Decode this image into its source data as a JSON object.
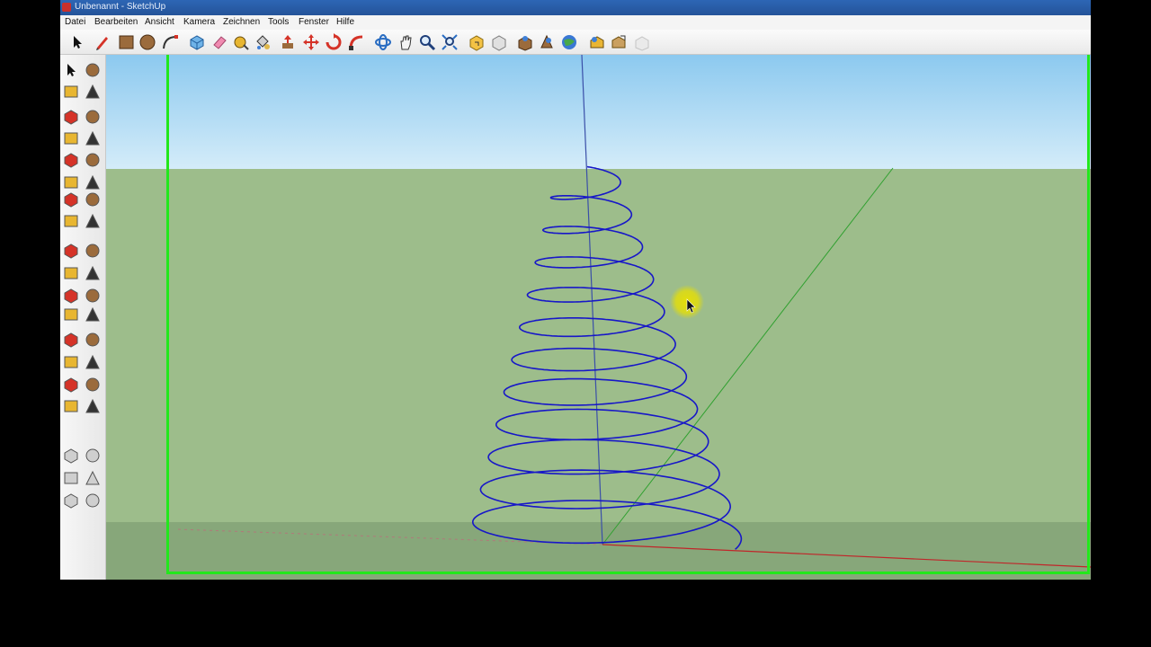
{
  "window": {
    "title": "Unbenannt - SketchUp"
  },
  "menu": {
    "items": [
      {
        "label": "Datei"
      },
      {
        "label": "Bearbeiten"
      },
      {
        "label": "Ansicht"
      },
      {
        "label": "Kamera"
      },
      {
        "label": "Zeichnen"
      },
      {
        "label": "Tools"
      },
      {
        "label": "Fenster"
      },
      {
        "label": "Hilfe"
      }
    ]
  },
  "colors": {
    "sky_top": "#8cc9ef",
    "sky_bottom": "#d4ecf9",
    "ground": "#9dbd8b",
    "ground_dark": "#87a77a",
    "spiral": "#1717c8",
    "axis_blue": "#3a4fa8",
    "axis_red": "#c0262a",
    "axis_green": "#2fa02f",
    "record_frame": "#22e81c",
    "cursor_highlight": "#e8e000"
  },
  "toolbar_top": {
    "icons": [
      "select-icon",
      "pencil-icon",
      "rectangle-icon",
      "circle-icon",
      "arc-icon",
      "make-component-icon",
      "eraser-icon",
      "tape-measure-icon",
      "paint-bucket-icon",
      "push-pull-icon",
      "move-icon",
      "rotate-icon",
      "follow-me-icon",
      "orbit-icon",
      "pan-icon",
      "zoom-icon",
      "zoom-extents-icon",
      "get-models-icon",
      "share-model-icon",
      "google-earth-icon",
      "earth-view-icon",
      "place-model-icon",
      "warehouse-icon",
      "export-icon"
    ]
  },
  "toolbar_side": {
    "icons": [
      "select-icon",
      "make-component-icon",
      "paint-bucket-icon",
      "eraser-icon",
      "rectangle-icon",
      "pencil-icon",
      "circle-icon",
      "arc-icon",
      "polygon-icon",
      "freehand-icon",
      "move-icon",
      "push-pull-icon",
      "rotate-icon",
      "follow-me-icon",
      "scale-icon",
      "offset-icon",
      "tape-measure-icon",
      "dimension-icon",
      "protractor-icon",
      "text-icon",
      "axes-icon",
      "3d-text-icon",
      "orbit-icon",
      "pan-icon",
      "zoom-icon",
      "zoom-window-icon",
      "previous-view-icon",
      "zoom-extents-icon",
      "position-camera-icon",
      "look-around-icon",
      "walk-icon",
      "section-plane-icon",
      "layers-icon",
      "intersect-icon",
      "union-icon",
      "subtract-icon",
      "trim-icon",
      "split-icon"
    ]
  }
}
